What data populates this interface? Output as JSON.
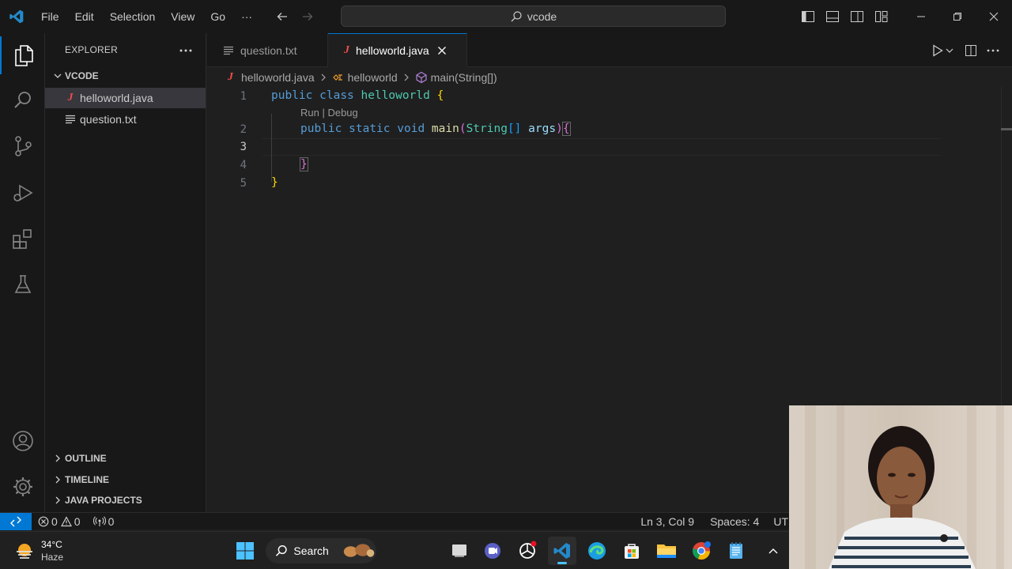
{
  "titlebar": {
    "menu": [
      "File",
      "Edit",
      "Selection",
      "View",
      "Go",
      "···"
    ],
    "search_text": "vcode"
  },
  "sidebar": {
    "header": "EXPLORER",
    "folder": "VCODE",
    "files": [
      {
        "name": "helloworld.java",
        "type": "java",
        "selected": true
      },
      {
        "name": "question.txt",
        "type": "text",
        "selected": false
      }
    ],
    "sections": [
      "OUTLINE",
      "TIMELINE",
      "JAVA PROJECTS"
    ]
  },
  "tabs": [
    {
      "label": "question.txt",
      "type": "text",
      "active": false
    },
    {
      "label": "helloworld.java",
      "type": "java",
      "active": true
    }
  ],
  "breadcrumb": {
    "file": "helloworld.java",
    "class": "helloworld",
    "method": "main(String[])"
  },
  "editor": {
    "line_numbers": [
      "1",
      "2",
      "3",
      "4",
      "5"
    ],
    "current_line": 3,
    "codelens": "Run | Debug"
  },
  "statusbar": {
    "errors": "0",
    "warnings": "0",
    "ports": "0",
    "position": "Ln 3, Col 9",
    "spaces": "Spaces: 4",
    "encoding": "UT"
  },
  "taskbar": {
    "temperature": "34°C",
    "condition": "Haze",
    "search_label": "Search"
  },
  "colors": {
    "accent": "#0078d4",
    "keyword": "#569cd6",
    "class_name": "#4ec9b0",
    "function": "#dcdcaa",
    "parameter": "#9cdcfe",
    "java_icon": "#f14c4c"
  }
}
